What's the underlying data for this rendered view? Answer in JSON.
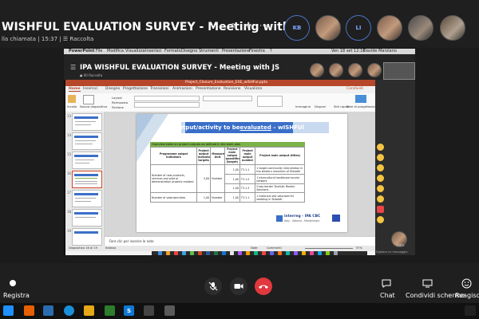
{
  "call": {
    "title": "WISHFUL EVALUATION SURVEY - Meeting with JS",
    "subtitle": "lla chiamata | 15:37 | ☰ Raccolta",
    "participants": [
      {
        "initials": "KB",
        "type": "ring"
      },
      {
        "initials": "",
        "type": "photo"
      },
      {
        "initials": "LI",
        "type": "ring"
      },
      {
        "initials": "",
        "type": "photo"
      },
      {
        "initials": "",
        "type": "photo"
      },
      {
        "initials": "",
        "type": "photo"
      }
    ]
  },
  "shared_screen": {
    "mac_menu": [
      "PowerPoint",
      "File",
      "Modifica",
      "Visualizza",
      "Inserisci",
      "Formato",
      "Disegno",
      "Strumenti",
      "Presentazione",
      "Finestra",
      "?"
    ],
    "clock": "Ven 18 set 12:10",
    "user": "Davide Marziano",
    "inner_title": "IPA WISHFUL EVALUATION SURVEY - Meeting with JS",
    "inner_subtitle": "● 00 Raccolta",
    "ppt_filename": "Project_Closure_Evaluation_EXE_wISHFul.pptx",
    "ppt_tabs": [
      "Home",
      "Inserisci",
      "Disegno",
      "Progettazione",
      "Transizioni",
      "Animazioni",
      "Presentazione",
      "Revisione",
      "Visualizza"
    ],
    "ppt_share": "Condividi",
    "ribbon": {
      "paste": "Incolla",
      "new_slide": "Nuova diapositiva",
      "layout": "Layout",
      "reset": "Reimposta",
      "section": "Sezione",
      "image": "Immagine",
      "arrange": "Disponi",
      "styles": "Stili rapidi",
      "designer": "Idee di progettazione"
    },
    "thumbnail_numbers": [
      "13",
      "14",
      "15",
      "16",
      "17",
      "18",
      "19"
    ],
    "slide": {
      "banner_prefix": "Output/activity to be ",
      "banner_emph": "evaluated",
      "banner_suffix": " – wISHFUl",
      "table_caption": "Overview table on project outputs as defined in the work plan",
      "headers": [
        "Programme output indicators",
        "Project output indicator targets",
        "Measurement Unit",
        "Project main output quantification (target)",
        "Project main output number",
        "Project main output (titles)"
      ],
      "rows": [
        {
          "indicator": "Number of new products, services and pilot or demonstration projects realized",
          "target": "3,00",
          "unit": "Number",
          "quant": "1,00",
          "num": "T3.1.1",
          "title": "1 target community intervention in the western mountain of Shkodër"
        },
        {
          "indicator": "",
          "target": "",
          "unit": "",
          "quant": "1,00",
          "num": "T3.1.2",
          "title": "1 Intercultural healthcare tourist network"
        },
        {
          "indicator": "",
          "target": "",
          "unit": "",
          "quant": "1,00",
          "num": "T3.1.3",
          "title": "Cross border Touristic Routes Solutions"
        },
        {
          "indicator": "Number of valorised sites",
          "target": "1,00",
          "unit": "Number",
          "quant": "1,00",
          "num": "T3.1.1",
          "title": "1 historical site valorised for wedding in Shkodër"
        }
      ],
      "logo_text": "interreg - IPA CBC",
      "logo_sub": "Italy - Albania - Montenegro"
    },
    "notes_placeholder": "Fare clic per inserire le note",
    "status_left": "Diapositiva 16 di 19",
    "status_lang": "Italiano",
    "status_notes": "Note",
    "status_comments": "Commenti",
    "status_zoom": "57%",
    "mini_video_label": "Altro",
    "mini_chat_hint": "Digitare un messaggio"
  },
  "toolbar": {
    "record": "Registra",
    "chat": "Chat",
    "share": "Condividi schermo",
    "react": "Reagisci"
  },
  "colors": {
    "ppt_accent": "#b7472a",
    "banner": "#3a6fc9",
    "table_header": "#7bb34a",
    "hangup": "#e0383e"
  }
}
